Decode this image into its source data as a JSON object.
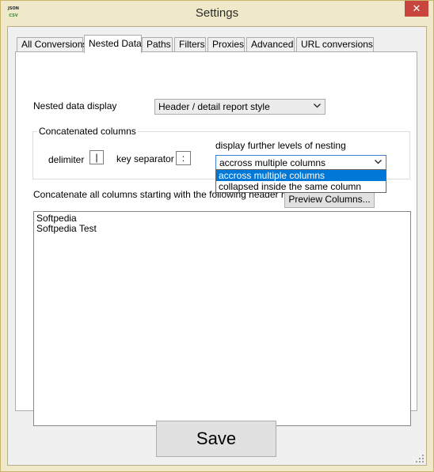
{
  "window": {
    "title": "Settings",
    "app_icon": {
      "line1": "JSON",
      "line2": "CSV"
    },
    "close_glyph": "✕"
  },
  "tabs": [
    {
      "label": "All Conversions",
      "active": false
    },
    {
      "label": "Nested Data",
      "active": true
    },
    {
      "label": "Paths",
      "active": false
    },
    {
      "label": "Filters",
      "active": false
    },
    {
      "label": "Proxies",
      "active": false
    },
    {
      "label": "Advanced",
      "active": false
    },
    {
      "label": "URL conversions",
      "active": false
    }
  ],
  "nested": {
    "display_label": "Nested data display",
    "display_value": "Header / detail report style"
  },
  "concat": {
    "group_title": "Concatenated columns",
    "delimiter_label": "delimiter",
    "delimiter_value": "|",
    "key_separator_label": "key separator",
    "key_separator_value": ":",
    "nesting_label": "display further levels of nesting",
    "nesting_value": "accross multiple columns",
    "nesting_options": [
      {
        "label": "accross multiple columns",
        "selected": true
      },
      {
        "label": "collapsed inside the same column",
        "selected": false
      }
    ]
  },
  "concat_all": {
    "label": "Concatenate all columns starting with the following header names",
    "preview_button": "Preview Columns...",
    "lines": [
      "Softpedia",
      "Softpedia Test"
    ]
  },
  "footer": {
    "save_label": "Save"
  }
}
